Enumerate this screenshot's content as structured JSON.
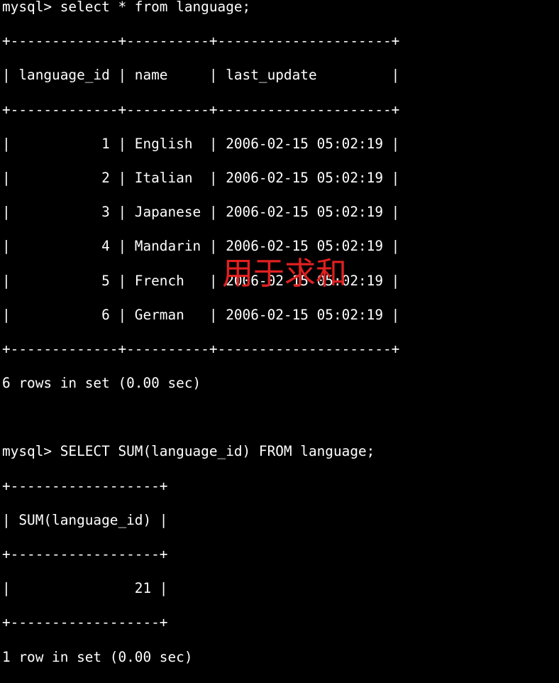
{
  "terminal": {
    "lines": [
      "mysql> select * from language;",
      "+-------------+----------+---------------------+",
      "| language_id | name     | last_update         |",
      "+-------------+----------+---------------------+",
      "|           1 | English  | 2006-02-15 05:02:19 |",
      "|           2 | Italian  | 2006-02-15 05:02:19 |",
      "|           3 | Japanese | 2006-02-15 05:02:19 |",
      "|           4 | Mandarin | 2006-02-15 05:02:19 |",
      "|           5 | French   | 2006-02-15 05:02:19 |",
      "|           6 | German   | 2006-02-15 05:02:19 |",
      "+-------------+----------+---------------------+",
      "6 rows in set (0.00 sec)",
      "",
      "mysql> SELECT SUM(language_id) FROM language;",
      "+------------------+",
      "| SUM(language_id) |",
      "+------------------+",
      "|               21 |",
      "+------------------+",
      "1 row in set (0.00 sec)"
    ]
  },
  "annotation": {
    "text": "用于求和",
    "color": "#e02020"
  },
  "colors": {
    "background": "#000000",
    "text": "#ffffff"
  }
}
